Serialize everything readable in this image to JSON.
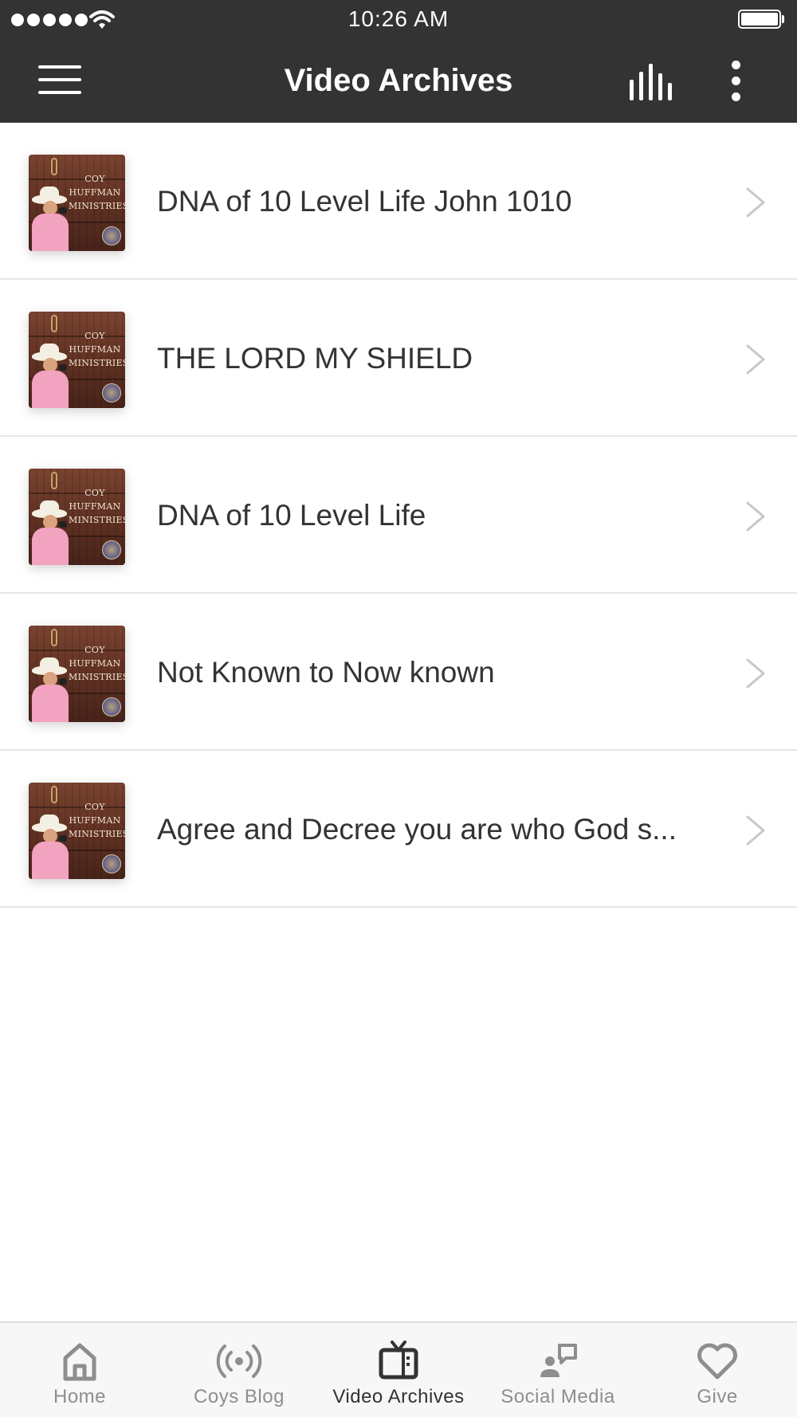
{
  "status_bar": {
    "time": "10:26 AM",
    "signal_icon": "cellular-signal-icon",
    "wifi_icon": "wifi-icon",
    "battery_icon": "battery-icon",
    "battery_level": 1.0
  },
  "header": {
    "title": "Video Archives",
    "menu_icon": "hamburger-menu-icon",
    "equalizer_icon": "audio-bars-icon",
    "more_icon": "more-vertical-icon",
    "background_color": "#333333"
  },
  "thumbnail_logo_lines": [
    "Coy",
    "Huffman",
    "Ministries"
  ],
  "videos": [
    {
      "title": "DNA of 10 Level Life John 1010"
    },
    {
      "title": "THE LORD MY SHIELD"
    },
    {
      "title": "DNA of 10 Level Life"
    },
    {
      "title": "Not Known to Now known"
    },
    {
      "title": "Agree and Decree you are who God s..."
    }
  ],
  "tabs": [
    {
      "label": "Home",
      "icon": "home-icon",
      "active": false
    },
    {
      "label": "Coys Blog",
      "icon": "broadcast-icon",
      "active": false
    },
    {
      "label": "Video Archives",
      "icon": "tv-icon",
      "active": true
    },
    {
      "label": "Social Media",
      "icon": "social-person-icon",
      "active": false
    },
    {
      "label": "Give",
      "icon": "heart-icon",
      "active": false
    }
  ],
  "colors": {
    "active_tab": "#333333",
    "inactive_tab": "#8e8e8e",
    "chevron": "#c7c7cc"
  }
}
